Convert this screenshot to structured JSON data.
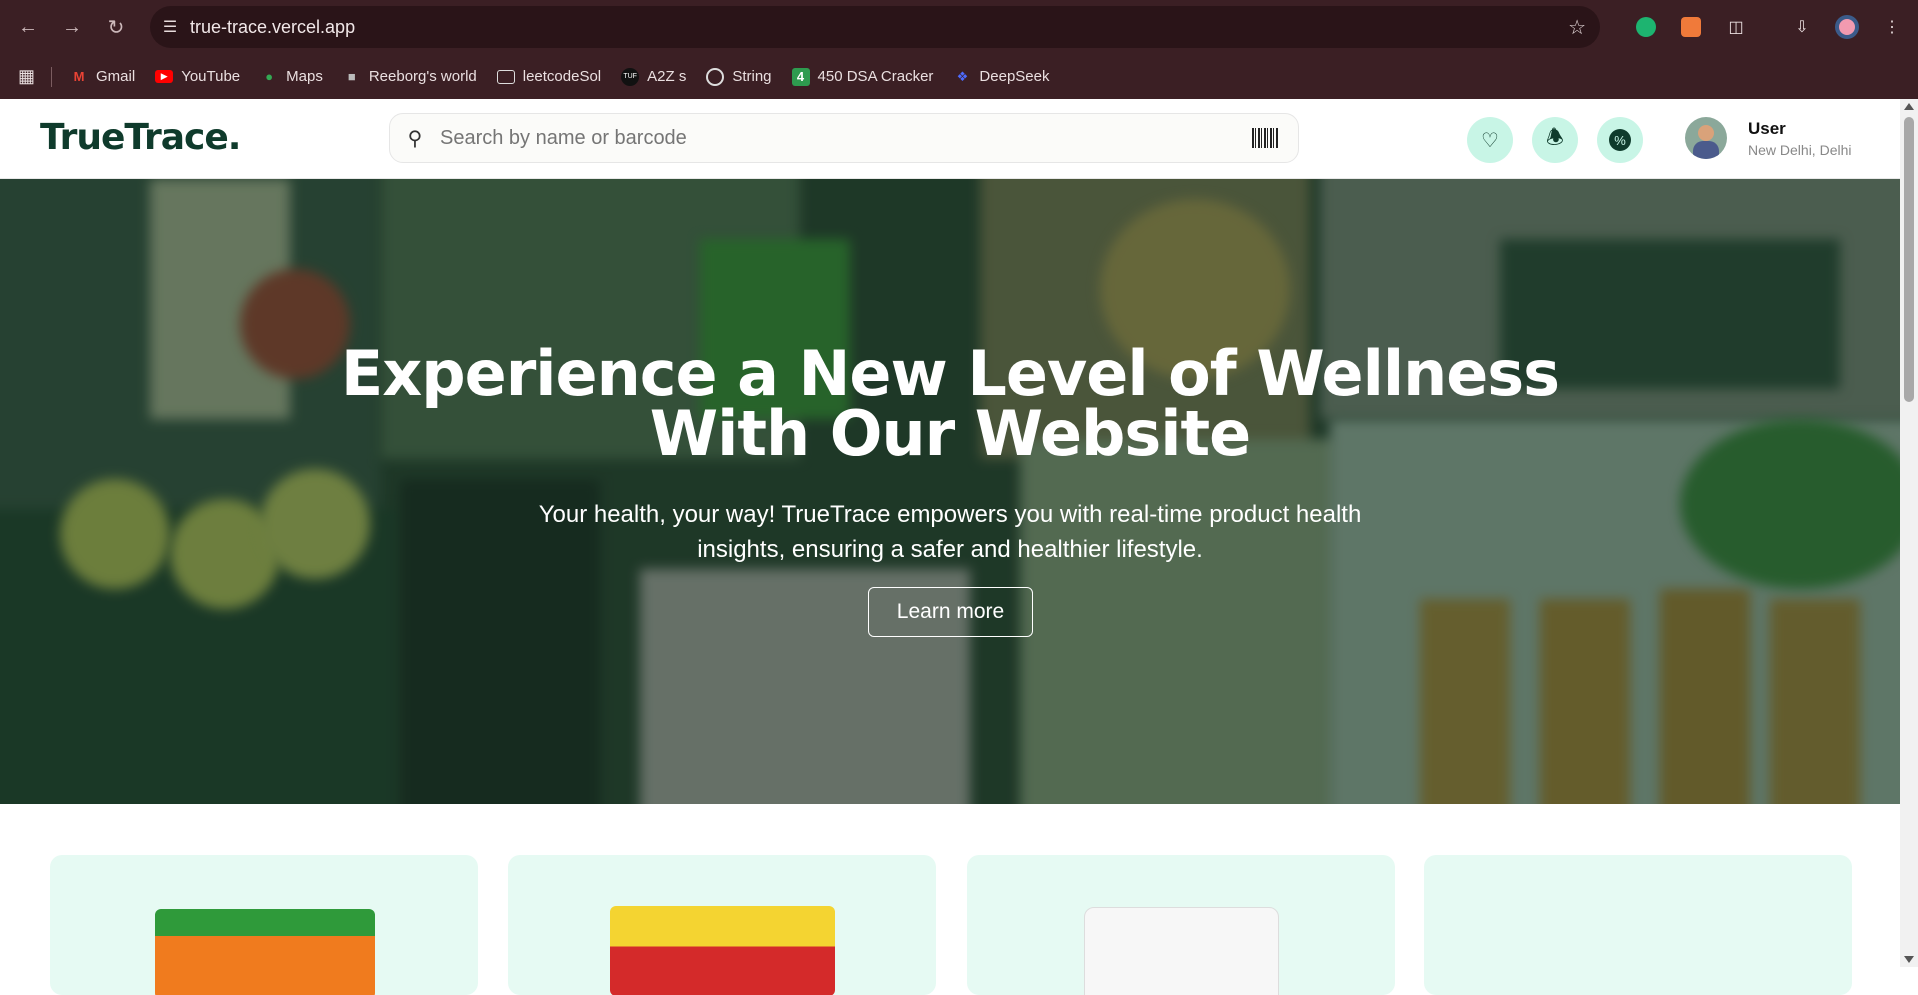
{
  "browser": {
    "url": "true-trace.vercel.app",
    "bookmarks": [
      {
        "label": "Gmail",
        "icon": "gmail-icon"
      },
      {
        "label": "YouTube",
        "icon": "youtube-icon"
      },
      {
        "label": "Maps",
        "icon": "maps-icon"
      },
      {
        "label": "Reeborg's world",
        "icon": "robot-icon"
      },
      {
        "label": "leetcodeSol",
        "icon": "folder-icon"
      },
      {
        "label": "A2Z s",
        "icon": "tuf-icon"
      },
      {
        "label": "String",
        "icon": "openai-icon"
      },
      {
        "label": "450 DSA Cracker",
        "icon": "number-4-icon"
      },
      {
        "label": "DeepSeek",
        "icon": "deepseek-icon"
      }
    ]
  },
  "header": {
    "logo": "TrueTrace.",
    "search_placeholder": "Search by name or barcode",
    "user": {
      "name": "User",
      "location": "New Delhi, Delhi"
    }
  },
  "hero": {
    "title_line1": "Experience a New Level of Wellness",
    "title_line2": "With Our Website",
    "subtitle_line1": "Your health, your way! TrueTrace empowers you with real-time product health",
    "subtitle_line2": "insights, ensuring a safer and healthier lifestyle.",
    "cta": "Learn more"
  },
  "colors": {
    "brand": "#0f3b2c",
    "accent": "#c8f5e6",
    "card_bg": "#e6faf3",
    "chrome": "#3b1f24"
  }
}
